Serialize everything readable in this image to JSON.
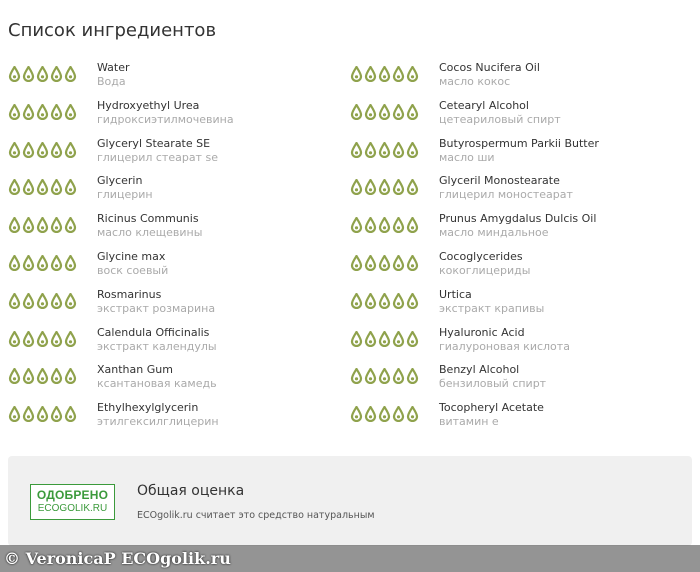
{
  "page": {
    "title": "Список ингредиентов"
  },
  "colors": {
    "rating_icon": "#8fa24c",
    "badge": "#3b9a3b"
  },
  "rating_icon": "green-drop-icon",
  "ingredients": [
    {
      "latin": "Water",
      "ru": "Вода",
      "rating": 5
    },
    {
      "latin": "Cocos Nucifera Oil",
      "ru": "масло кокос",
      "rating": 5
    },
    {
      "latin": "Hydroxyethyl Urea",
      "ru": "гидроксиэтилмочевина",
      "rating": 5
    },
    {
      "latin": "Cetearyl Alcohol",
      "ru": "цетеариловый спирт",
      "rating": 5
    },
    {
      "latin": "Glyceryl Stearate SE",
      "ru": "глицерил стеарат se",
      "rating": 5
    },
    {
      "latin": "Butyrospermum Parkii Butter",
      "ru": "масло ши",
      "rating": 5
    },
    {
      "latin": "Glycerin",
      "ru": "глицерин",
      "rating": 5
    },
    {
      "latin": "Glyceril Monostearate",
      "ru": "глицерил моностеарат",
      "rating": 5
    },
    {
      "latin": "Ricinus Communis",
      "ru": "масло клещевины",
      "rating": 5
    },
    {
      "latin": "Prunus Amygdalus Dulcis Oil",
      "ru": "масло миндальное",
      "rating": 5
    },
    {
      "latin": "Glycine max",
      "ru": "воск соевый",
      "rating": 5
    },
    {
      "latin": "Cocoglycerides",
      "ru": "кокоглицериды",
      "rating": 5
    },
    {
      "latin": "Rosmarinus",
      "ru": "экстракт розмарина",
      "rating": 5
    },
    {
      "latin": "Urtica",
      "ru": "экстракт крапивы",
      "rating": 5
    },
    {
      "latin": "Calendula Officinalis",
      "ru": "экстракт календулы",
      "rating": 5
    },
    {
      "latin": "Hyaluronic Acid",
      "ru": "гиалуроновая кислота",
      "rating": 5
    },
    {
      "latin": "Xanthan Gum",
      "ru": "ксантановая камедь",
      "rating": 5
    },
    {
      "latin": "Benzyl Alcohol",
      "ru": "бензиловый спирт",
      "rating": 5
    },
    {
      "latin": "Ethylhexylglycerin",
      "ru": "этилгексилглицерин",
      "rating": 5
    },
    {
      "latin": "Tocopheryl Acetate",
      "ru": "витамин е",
      "rating": 5
    }
  ],
  "summary": {
    "badge_line1": "ОДОБРЕНО",
    "badge_line2": "ECOGOLIK.RU",
    "title": "Общая оценка",
    "text": "ECOgolik.ru считает это средство натуральным"
  },
  "watermark": {
    "text": "© VeronicaP  ECOgolik.ru"
  }
}
